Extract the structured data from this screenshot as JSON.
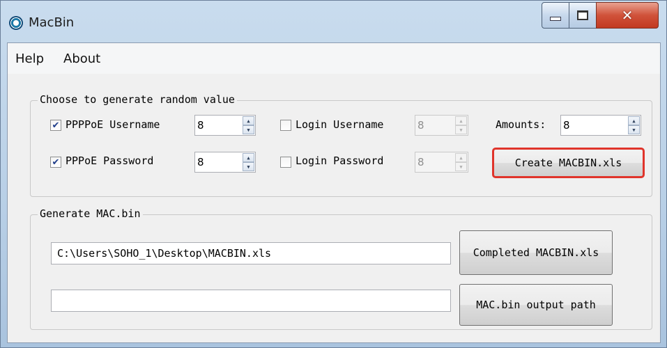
{
  "window": {
    "title": "MacBin"
  },
  "menu": {
    "items": [
      "Help",
      "About"
    ]
  },
  "random_group": {
    "title": "Choose to generate random value",
    "pppoe_username": {
      "label": "PPPPoE Username",
      "checked": true,
      "value": "8"
    },
    "pppoe_password": {
      "label": "PPPoE Password",
      "checked": true,
      "value": "8"
    },
    "login_username": {
      "label": "Login Username",
      "checked": false,
      "value": "8"
    },
    "login_password": {
      "label": "Login Password",
      "checked": false,
      "value": "8"
    },
    "amounts": {
      "label": "Amounts:",
      "value": "8"
    },
    "create_button": "Create MACBIN.xls"
  },
  "macbin_group": {
    "title": "Generate MAC.bin",
    "xls_path": "C:\\Users\\SOHO_1\\Desktop\\MACBIN.xls",
    "output_path": "",
    "completed_button": "Completed MACBIN.xls",
    "output_button": "MAC.bin output path"
  },
  "colors": {
    "highlight": "#e0342b",
    "close_button": "#c23a22"
  },
  "icons": {
    "app": "macbin-app-icon",
    "check": "checkmark-icon"
  }
}
